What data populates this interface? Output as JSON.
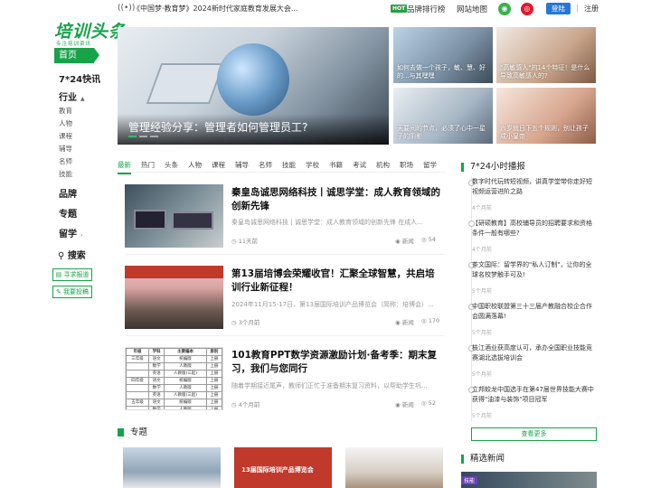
{
  "header": {
    "ticker": "《中国梦·教育梦》2024新时代家庭教育发展大会...",
    "hot_badge": "HOT",
    "brand_rank": "品牌排行榜",
    "sitemap": "网站地图",
    "login": "登陆",
    "separator": "|",
    "register": "注册",
    "colors": {
      "wechat": "#36b24a",
      "weibo": "#e6162d",
      "login": "#2777d6"
    }
  },
  "sidebar": {
    "logo": "培训头条",
    "logo_sub": "专注培训资讯",
    "home": "首页",
    "kuaixun": "7*24快讯",
    "industry": "行业",
    "industry_items": [
      "教育",
      "人物",
      "课程",
      "辅导",
      "名师",
      "技能"
    ],
    "brand": "品牌",
    "topic": "专题",
    "study_abroad": "留学",
    "search": "搜索",
    "find_training": "寻求报道",
    "submit": "我要投稿"
  },
  "hero": {
    "main_title": "管理经验分享：管理者如何管理员工?",
    "thumbs": [
      {
        "caption": "如何去做一个孩子，敏、慧、好的...与其嘿嘿"
      },
      {
        "caption": "\"高敏感人\"的14个特征！是什么导致高敏感人的?"
      },
      {
        "caption": "天要间的节点，必须了心中一星子的阴影"
      },
      {
        "caption": "六岁就日下五个规则，别让孩子成小皇帝"
      }
    ]
  },
  "tabs": [
    "最新",
    "热门",
    "头条",
    "人物",
    "课程",
    "辅导",
    "名师",
    "技能",
    "学校",
    "书籍",
    "考试",
    "机构",
    "职场",
    "留学"
  ],
  "articles": [
    {
      "title": "秦皇岛诚思网络科技丨诚思学堂：成人教育领域的创新先锋",
      "desc": "秦皇岛诚思网络科技丨诚思学堂：成人教育领域的创新先锋 在成人...",
      "time": "11天前",
      "category": "新闻",
      "views": "54"
    },
    {
      "title": "第13届培博会荣耀收官！汇聚全球智慧，共启培训行业新征程！",
      "desc": "2024年11月15-17日，第13届国际培训产品博览会（简称：培博会）...",
      "time": "3个月前",
      "category": "新闻",
      "views": "170"
    },
    {
      "title": "101教育PPT数学资源激励计划·备考季：期末复习，我们与您同行",
      "desc": "随着学期接近尾声，教师们正忙于准备期末复习资料，以帮助学生巩...",
      "time": "4个月前",
      "category": "新闻",
      "views": "52"
    }
  ],
  "schedule_table": {
    "headers": [
      "年级",
      "学科",
      "主要编本",
      "册别"
    ],
    "rows": [
      [
        "三年级",
        "语文",
        "统编版",
        "上册"
      ],
      [
        "",
        "数学",
        "人教版",
        "上册"
      ],
      [
        "",
        "英语",
        "人教版(三起)",
        "上册"
      ],
      [
        "四年级",
        "语文",
        "统编版",
        "上册"
      ],
      [
        "",
        "数学",
        "人教版",
        "上册"
      ],
      [
        "",
        "英语",
        "人教版(三起)",
        "上册"
      ],
      [
        "五年级",
        "语文",
        "统编版",
        "上册"
      ],
      [
        "",
        "数学",
        "人教版",
        "上册"
      ]
    ]
  },
  "right": {
    "feed_title": "7*24小时播报",
    "feed": [
      {
        "text": "数字时代玩转短视频，讲真学堂带你走好短视频运营进阶之路",
        "time": "4个月前"
      },
      {
        "text": "【研硕教育】高校辅导员的招聘要求和资格条件一般有哪些?",
        "time": "4个月前"
      },
      {
        "text": "茶文国际：留学界的\"私人订制\"，让你的全球名校梦触手可及!",
        "time": "5个月前"
      },
      {
        "text": "中国职校联盟第三十三届产教融合校企合作会圆满落幕!",
        "time": "5个月前"
      },
      {
        "text": "枝江酒业获高度认可，承办全国职业技能竞赛湖北选拔培训会",
        "time": "5个月前"
      },
      {
        "text": "立邦蛟龙中国选手在第47届世界技能大赛中获得\"油漆与装饰\"项目冠军",
        "time": "5个月前"
      }
    ],
    "more": "查看更多",
    "selected_title": "精选新闻",
    "selected_tag": "技能"
  },
  "topic": {
    "title": "专题",
    "banner_text": "13届国际培训产品博览会"
  }
}
